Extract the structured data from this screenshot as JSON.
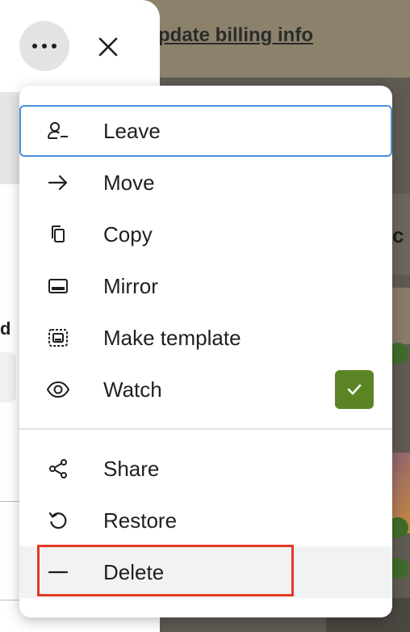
{
  "background": {
    "banner_link": "pdate billing info",
    "card_letter": "c"
  },
  "header": {
    "more_icon": "more-horizontal-icon",
    "close_icon": "close-icon"
  },
  "menu": {
    "items": [
      {
        "label": "Leave",
        "icon": "user-minus-icon"
      },
      {
        "label": "Move",
        "icon": "arrow-right-icon"
      },
      {
        "label": "Copy",
        "icon": "copy-icon"
      },
      {
        "label": "Mirror",
        "icon": "mirror-icon"
      },
      {
        "label": "Make template",
        "icon": "template-icon"
      },
      {
        "label": "Watch",
        "icon": "eye-icon",
        "checked": true
      },
      {
        "label": "Share",
        "icon": "share-icon"
      },
      {
        "label": "Restore",
        "icon": "restore-icon"
      },
      {
        "label": "Delete",
        "icon": "minus-icon"
      }
    ]
  },
  "colors": {
    "focus_outline": "#4b8fe0",
    "check_badge": "#5b8424",
    "highlight": "#e23a22"
  }
}
